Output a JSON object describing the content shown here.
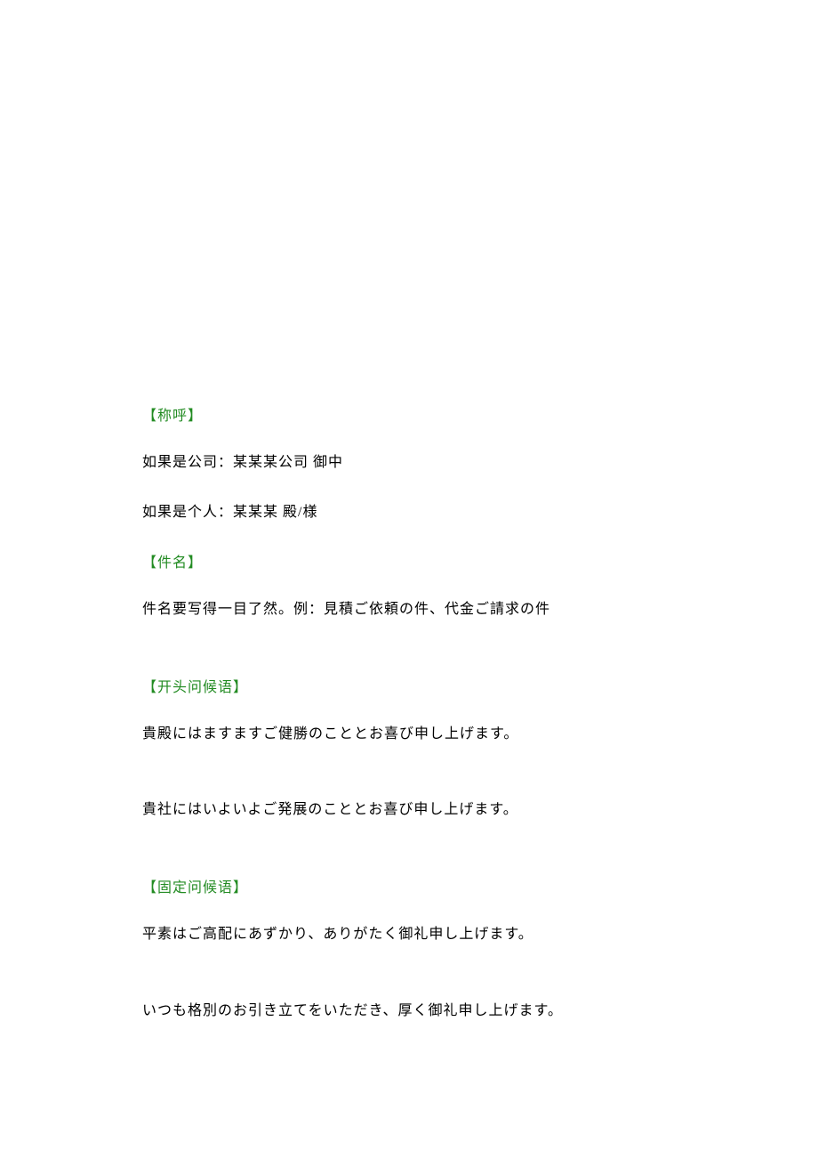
{
  "sections": [
    {
      "heading": "【称呼】",
      "lines": [
        "如果是公司：某某某公司 御中",
        "如果是个人：某某某 殿/様"
      ]
    },
    {
      "heading": "【件名】",
      "lines": [
        "件名要写得一目了然。例：見積ご依頼の件、代金ご請求の件"
      ]
    },
    {
      "heading": "【开头问候语】",
      "lines": [
        "貴殿にはますますご健勝のこととお喜び申し上げます。",
        "貴社にはいよいよご発展のこととお喜び申し上げます。"
      ]
    },
    {
      "heading": "【固定问候语】",
      "lines": [
        "平素はご高配にあずかり、ありがたく御礼申し上げます。",
        "いつも格別のお引き立てをいただき、厚く御礼申し上げます。"
      ]
    }
  ]
}
